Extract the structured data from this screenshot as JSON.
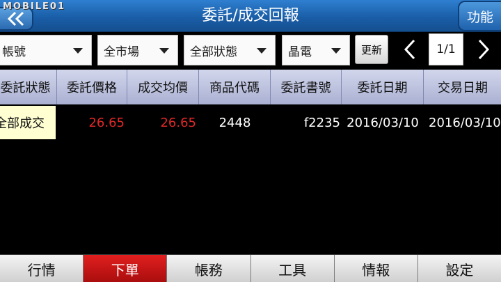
{
  "header": {
    "watermark": "MOBILE01",
    "title": "委託/成交回報",
    "function_label": "功能"
  },
  "filters": {
    "account": "帳號",
    "market": "全市場",
    "status": "全部狀態",
    "stock": "晶電",
    "refresh_label": "更新",
    "page": "1/1"
  },
  "table": {
    "columns": [
      "委託狀態",
      "委託價格",
      "成交均價",
      "商品代碼",
      "委託書號",
      "委託日期",
      "交易日期"
    ],
    "rows": [
      [
        "全部成交",
        "26.65",
        "26.65",
        "2448",
        "f2235",
        "2016/03/10",
        "2016/03/10"
      ]
    ]
  },
  "tabs": [
    {
      "label": "行情"
    },
    {
      "label": "下單"
    },
    {
      "label": "帳務"
    },
    {
      "label": "工具"
    },
    {
      "label": "情報"
    },
    {
      "label": "設定"
    }
  ],
  "colors": {
    "header_blue": "#1a5ea8",
    "price_red": "#e02828",
    "active_tab_red": "#c01515",
    "status_cell": "#ffffd2"
  }
}
